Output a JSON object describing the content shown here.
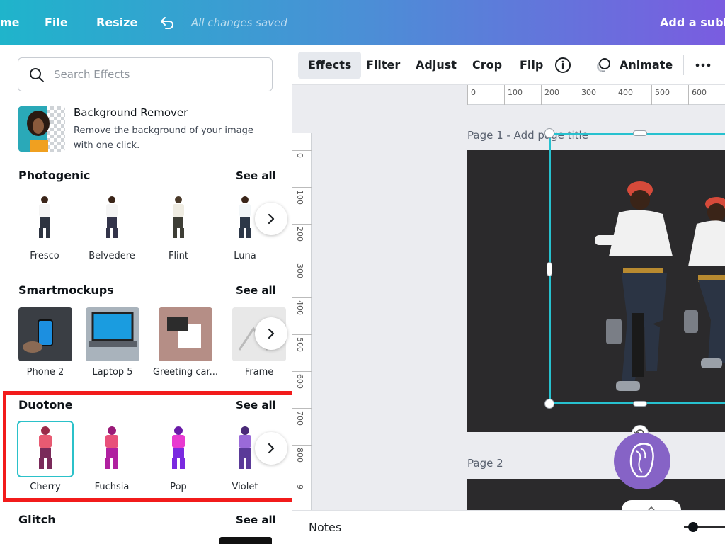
{
  "topbar": {
    "home_label": "me",
    "file_label": "File",
    "resize_label": "Resize",
    "status": "All changes saved",
    "subheading": "Add a subhe"
  },
  "search": {
    "placeholder": "Search Effects"
  },
  "bg_remover": {
    "title": "Background Remover",
    "description": "Remove the background of your image with one click."
  },
  "sections": {
    "photogenic": {
      "title": "Photogenic",
      "see_all": "See all",
      "items": [
        "Fresco",
        "Belvedere",
        "Flint",
        "Luna"
      ]
    },
    "smartmockups": {
      "title": "Smartmockups",
      "see_all": "See all",
      "items": [
        "Phone 2",
        "Laptop 5",
        "Greeting car...",
        "Frame"
      ]
    },
    "duotone": {
      "title": "Duotone",
      "see_all": "See all",
      "items": [
        "Cherry",
        "Fuchsia",
        "Pop",
        "Violet"
      ],
      "selected": "Cherry"
    },
    "glitch": {
      "title": "Glitch",
      "see_all": "See all"
    }
  },
  "toolbar": {
    "effects": "Effects",
    "filter": "Filter",
    "adjust": "Adjust",
    "crop": "Crop",
    "flip": "Flip",
    "animate": "Animate"
  },
  "ruler": {
    "top": [
      "0",
      "100",
      "200",
      "300",
      "400",
      "500",
      "600"
    ],
    "left": [
      "0",
      "100",
      "200",
      "300",
      "400",
      "500",
      "600",
      "700",
      "800",
      "9"
    ]
  },
  "pages": {
    "page1_label": "Page 1 - Add page title",
    "page2_label": "Page 2"
  },
  "notes_label": "Notes",
  "colors": {
    "accent": "#27c1cf",
    "highlight": "#f21b1b",
    "fab": "#8663c6",
    "canvas": "#2b2a2c",
    "duotone": [
      "#e85a72",
      "#e83aa0",
      "#c23ae8",
      "#8a5ad6"
    ]
  }
}
